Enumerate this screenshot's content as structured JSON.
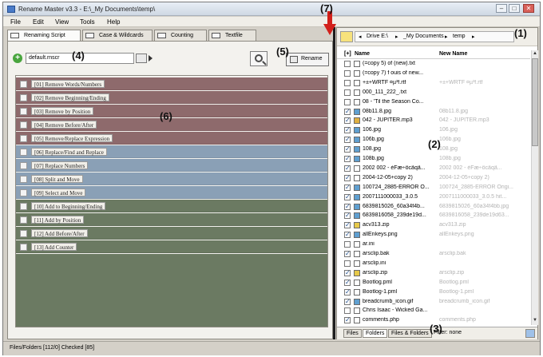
{
  "window": {
    "title": "Rename Master v3.3 - E:\\_My Documents\\temp\\",
    "controls": [
      "–",
      "□",
      "✕"
    ]
  },
  "menu": [
    "File",
    "Edit",
    "View",
    "Tools",
    "Help"
  ],
  "tabs": [
    {
      "label": "Renaming Script",
      "active": true
    },
    {
      "label": "Case & Wildcards",
      "active": false
    },
    {
      "label": "Counting",
      "active": false
    },
    {
      "label": "Textfile",
      "active": false
    }
  ],
  "preset": {
    "value": "default.rnscr"
  },
  "toolbar": {
    "rename_label": "Rename"
  },
  "scripts": [
    {
      "label": "[01]  Remove Words/Numbers",
      "group": "remove"
    },
    {
      "label": "[02]  Remove Beginning/Ending",
      "group": "remove"
    },
    {
      "label": "[03]  Remove by Position",
      "group": "remove"
    },
    {
      "label": "[04]  Remove Before/After",
      "group": "remove"
    },
    {
      "label": "[05]  Remove/Replace Expression",
      "group": "remove"
    },
    {
      "label": "[06]  Replace/Find and Replace",
      "group": "replace"
    },
    {
      "label": "[07]  Replace Numbers",
      "group": "replace"
    },
    {
      "label": "[08]  Split and Move",
      "group": "replace"
    },
    {
      "label": "[09]  Select and Move",
      "group": "replace"
    },
    {
      "label": "[10]  Add to Beginning/Ending",
      "group": "add"
    },
    {
      "label": "[11]  Add by Position",
      "group": "add"
    },
    {
      "label": "[12]  Add Before/After",
      "group": "add"
    },
    {
      "label": "[13]  Add Counter",
      "group": "add"
    }
  ],
  "colors": {
    "remove": "#8e6a6c",
    "replace": "#8aa0b6",
    "add": "#6b7a62"
  },
  "breadcrumb": [
    "Drive E:\\",
    "_My Documents",
    "temp"
  ],
  "filelist": {
    "headers": {
      "toggle": "[+]",
      "name": "Name",
      "new_name": "New Name"
    },
    "rows": [
      {
        "name": "(=copy 5) of (new).txt",
        "new": "",
        "checked": false,
        "icon": "text-file-icon"
      },
      {
        "name": "(=copy 7) f ouis of new...",
        "new": "",
        "checked": false,
        "icon": "text-file-icon"
      },
      {
        "name": "+±+WRTF ¤µ³f.rtf",
        "new": "+±+WRTF ¤µ³f.rtf",
        "checked": false,
        "icon": "text-file-icon"
      },
      {
        "name": "000_111_222_.txt",
        "new": "",
        "checked": false,
        "icon": "text-file-icon"
      },
      {
        "name": "08 - 'Til the Season Co...",
        "new": "",
        "checked": false,
        "icon": "text-file-icon"
      },
      {
        "name": "08b11.8.jpg",
        "new": "08b11.8.jpg",
        "checked": true,
        "icon": "image-file-icon"
      },
      {
        "name": "042 - JUPITER.mp3",
        "new": "042 - JUPITER.mp3",
        "checked": true,
        "icon": "audio-file-icon"
      },
      {
        "name": "106.jpg",
        "new": "106.jpg",
        "checked": true,
        "icon": "image-file-icon"
      },
      {
        "name": "106b.jpg",
        "new": "106b.jpg",
        "checked": true,
        "icon": "image-file-icon"
      },
      {
        "name": "108.jpg",
        "new": "108.jpg",
        "checked": true,
        "icon": "image-file-icon"
      },
      {
        "name": "108b.jpg",
        "new": "108b.jpg",
        "checked": true,
        "icon": "image-file-icon"
      },
      {
        "name": "2002 002 - éFæ÷ôcãqã...",
        "new": "2002 002 - éFæ÷ôcãqã...",
        "checked": true,
        "icon": "text-file-icon"
      },
      {
        "name": "2004-12-05+copy 2)",
        "new": "2004-12-05+copy 2)",
        "checked": true,
        "icon": "text-file-icon"
      },
      {
        "name": "100724_2885-ERROR O...",
        "new": "100724_2885-ERROR Origi...",
        "checked": true,
        "icon": "image-file-icon"
      },
      {
        "name": "2007111000033_3.0.5",
        "new": "2007111000033_3.0.5 hit...",
        "checked": true,
        "icon": "image-file-icon"
      },
      {
        "name": "6839815026_60a34f4b...",
        "new": "6839815026_60a34f4bb.jpg",
        "checked": true,
        "icon": "image-file-icon"
      },
      {
        "name": "6839816058_239de19d...",
        "new": "6839816058_239de19d63...",
        "checked": true,
        "icon": "image-file-icon"
      },
      {
        "name": "acv313.zip",
        "new": "acv313.zip",
        "checked": true,
        "icon": "zip-file-icon"
      },
      {
        "name": "allEnkeys.png",
        "new": "allEnkeys.png",
        "checked": true,
        "icon": "image-file-icon"
      },
      {
        "name": "ar.ini",
        "new": "",
        "checked": false,
        "icon": "text-file-icon"
      },
      {
        "name": "arsclip.bak",
        "new": "arsclip.bak",
        "checked": true,
        "icon": "text-file-icon"
      },
      {
        "name": "arsclip.ini",
        "new": "",
        "checked": false,
        "icon": "text-file-icon"
      },
      {
        "name": "arsclip.zip",
        "new": "arsclip.zip",
        "checked": true,
        "icon": "zip-file-icon"
      },
      {
        "name": "Bootlog.pml",
        "new": "Bootlog.pml",
        "checked": true,
        "icon": "text-file-icon"
      },
      {
        "name": "Bootlog-1.pml",
        "new": "Bootlog-1.pml",
        "checked": true,
        "icon": "text-file-icon"
      },
      {
        "name": "breadcrumb_icon.gif",
        "new": "breadcrumb_icon.gif",
        "checked": true,
        "icon": "image-file-icon"
      },
      {
        "name": "Chris Isaac - Wicked Ga...",
        "new": "",
        "checked": false,
        "icon": "text-file-icon"
      },
      {
        "name": "comments.php",
        "new": "comments.php",
        "checked": true,
        "icon": "text-file-icon"
      }
    ]
  },
  "bottom_tabs": [
    {
      "label": "Files",
      "active": false
    },
    {
      "label": "Folders",
      "active": true
    },
    {
      "label": "Files & Folders",
      "active": false
    },
    {
      "label": "Filter: none",
      "active": false
    }
  ],
  "status": {
    "text": "Files/Folders [112/0] Checked [85]"
  },
  "callouts": [
    "(1)",
    "(2)",
    "(3)",
    "(4)",
    "(5)",
    "(6)",
    "(7)"
  ]
}
